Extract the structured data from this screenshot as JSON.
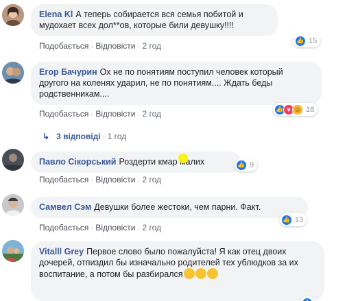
{
  "comments": [
    {
      "author": "Elena Kl",
      "text": "А теперь собирается вся семья побитой и мудохает всех дол**ов, которые били девушку!!!!",
      "like_label": "Подобається",
      "reply_label": "Відповісти",
      "time": "2 год",
      "reaction_count": "15",
      "reactions": [
        "like"
      ]
    },
    {
      "author": "Егор Бачурин",
      "text": "Ох не по понятиям поступил человек который другого на коленях ударил, не по понятиям.... Ждать беды родственникам....",
      "like_label": "Подобається",
      "reply_label": "Відповісти",
      "time": "2 год",
      "reaction_count": "18",
      "reactions": [
        "like",
        "love",
        "haha"
      ],
      "replies_label": "3 відповіді",
      "replies_time": "1 год"
    },
    {
      "author": "Павло Сікорський",
      "text": "Роздерти кмар малих",
      "like_label": "Подобається",
      "reply_label": "Відповісти",
      "time": "2 год",
      "reaction_count": "9",
      "reactions": [
        "like"
      ]
    },
    {
      "author": "Самвел Сэм",
      "text": "Девушки более жестоки, чем парни. Факт.",
      "like_label": "Подобається",
      "reply_label": "Відповісти",
      "time": "2 год",
      "reaction_count": "13",
      "reactions": [
        "like"
      ]
    },
    {
      "author": "Vitalll Grey",
      "text": "Первое слово было пожалуйста! Я как отец двоих дочерей, отпиздил бы изначально родителей тех ублюдков за их воспитание, а потом бы разбирался",
      "reactions": [
        "like"
      ]
    }
  ],
  "colors": {
    "author": "#385898",
    "bubble": "#f2f3f5",
    "like": "#1877f2",
    "love": "#f33e58",
    "haha": "#f7b125",
    "cursor": "#f6f20a"
  },
  "icons": {
    "reply_arrow": "reply-arrow-icon",
    "like": "like-icon",
    "love": "love-icon",
    "haha": "haha-icon",
    "emoji": "grimace-emoji"
  }
}
